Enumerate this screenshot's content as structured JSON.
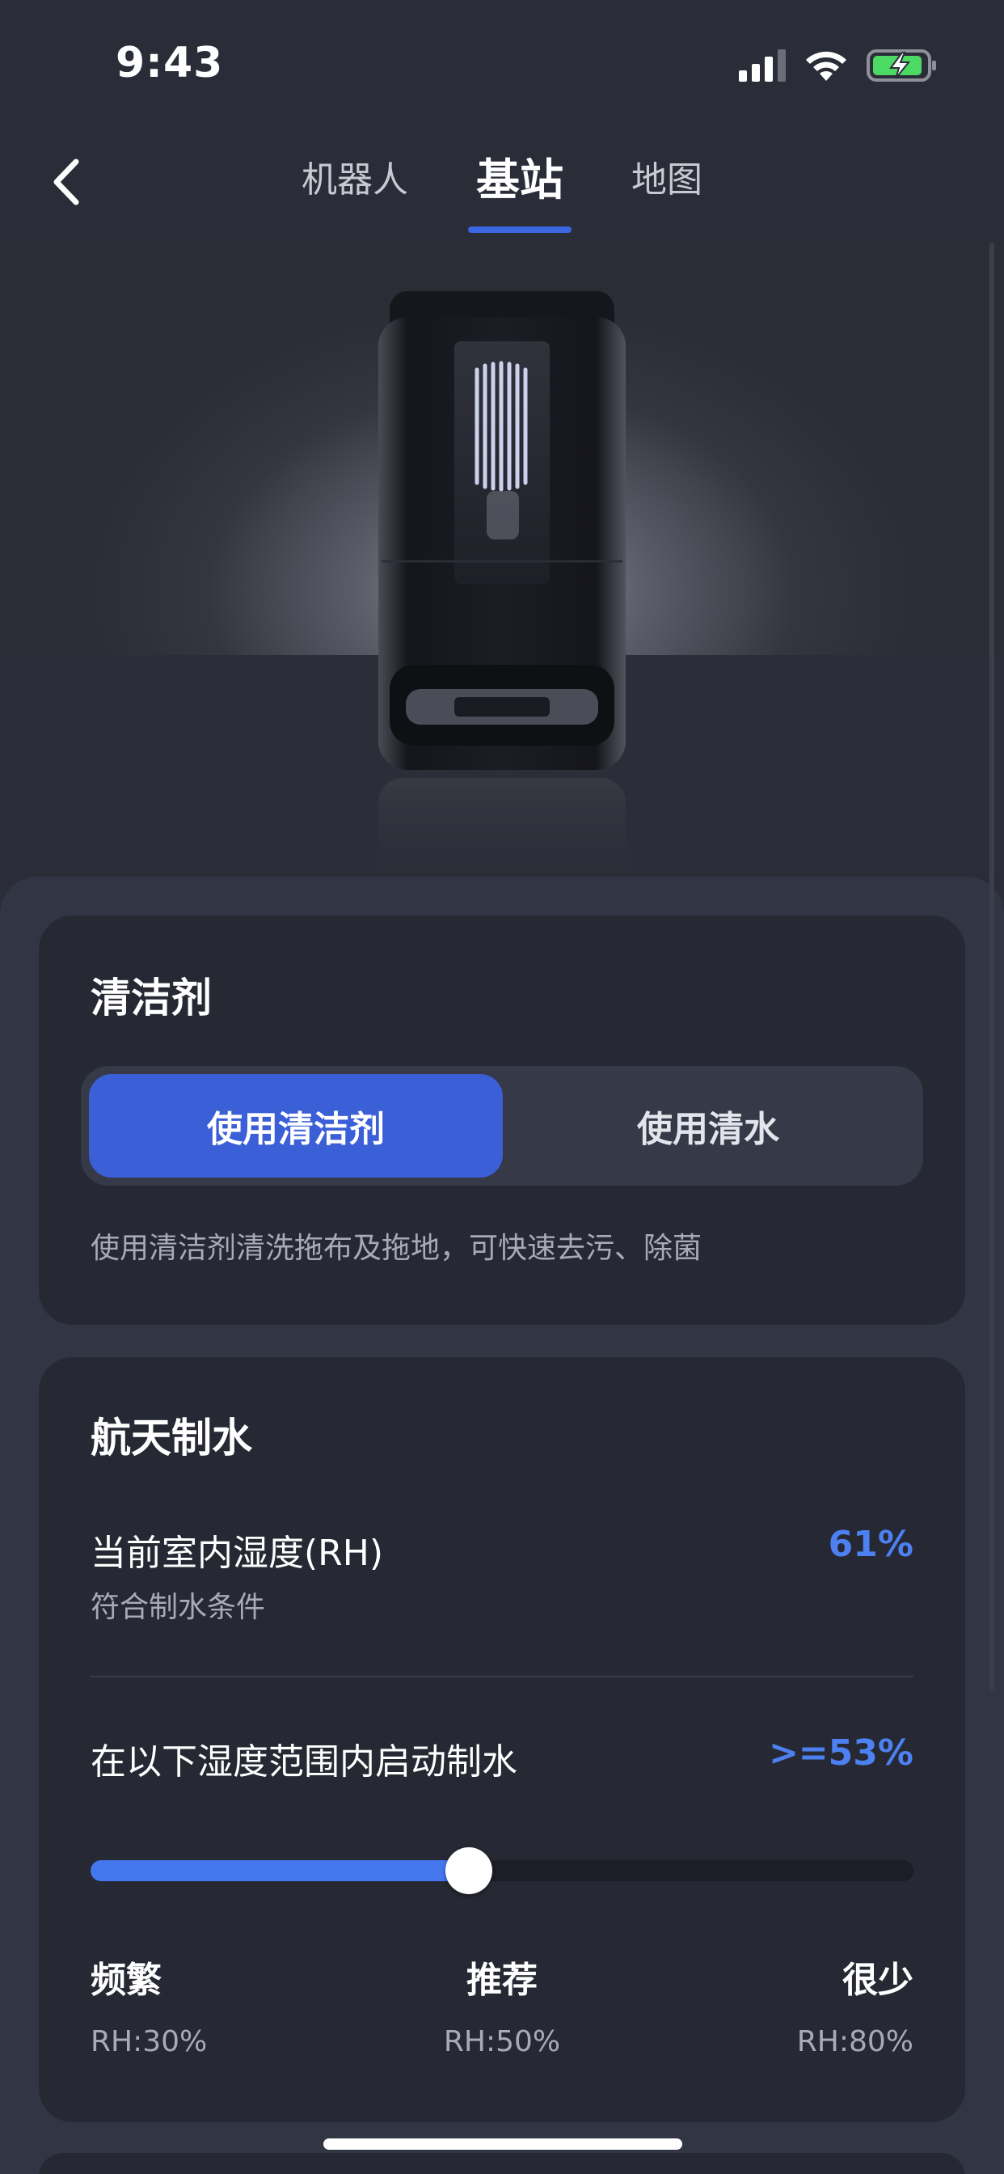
{
  "status_bar": {
    "time": "9:43",
    "icons": [
      "cellular-signal-icon",
      "wifi-icon",
      "battery-charging-icon"
    ],
    "battery_color": "#4cd964"
  },
  "nav": {
    "back_icon": "chevron-left-icon",
    "tabs": [
      {
        "label": "机器人",
        "active": false
      },
      {
        "label": "基站",
        "active": true
      },
      {
        "label": "地图",
        "active": false
      }
    ],
    "accent": "#3a66e0"
  },
  "cleaner": {
    "title": "清洁剂",
    "options": [
      "使用清洁剂",
      "使用清水"
    ],
    "selected": "使用清洁剂",
    "description": "使用清洁剂清洗拖布及拖地，可快速去污、除菌"
  },
  "water": {
    "title": "航天制水",
    "humidity_label": "当前室内湿度(RH)",
    "humidity_status": "符合制水条件",
    "humidity_value": "61%",
    "threshold_label": "在以下湿度范围内启动制水",
    "threshold_value": ">=53%",
    "slider_fraction": 0.46,
    "levels": [
      {
        "name": "频繁",
        "rh": "RH:30%"
      },
      {
        "name": "推荐",
        "rh": "RH:50%"
      },
      {
        "name": "很少",
        "rh": "RH:80%"
      }
    ],
    "value_color": "#4d80f0"
  }
}
